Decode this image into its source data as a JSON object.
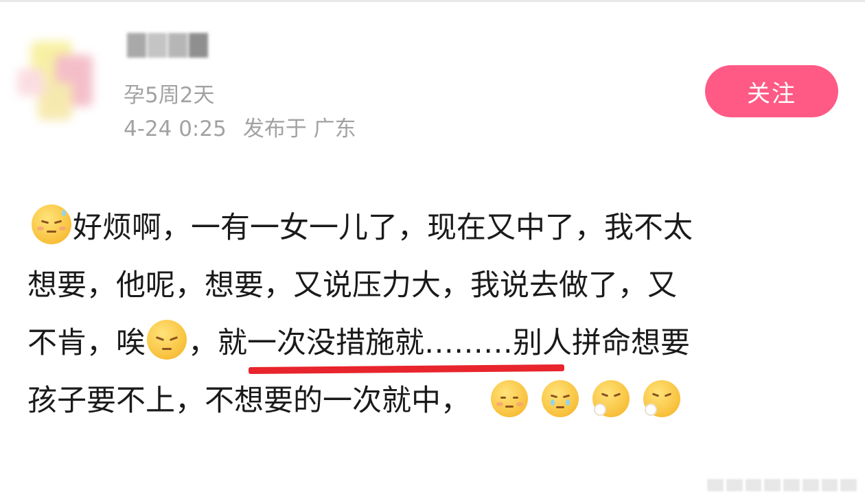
{
  "post": {
    "author": {
      "name_hidden": true,
      "pregnancy_status": "孕5周2天"
    },
    "posted_time": "4-24 0:25",
    "location": "发布于 广东",
    "follow_label": "关注",
    "content": {
      "line1": "好烦啊，一有一女一儿了，现在又中了，我不太",
      "line2": "想要，他呢，想要，又说压力大，我说去做了，又",
      "line3_a": "不肯，唉",
      "line3_b": "，就一次没措施就………别人拼命想要",
      "line4": "孩子要不上，不想要的一次就中，"
    },
    "emoji": {
      "start": "sweat-sad-emoji",
      "inline": "pensive-face-emoji",
      "trailing": [
        "crying-face-emoji",
        "tearful-face-emoji",
        "sighing-face-emoji",
        "sighing-face-emoji"
      ]
    },
    "colors": {
      "follow_button": "#fe5a85",
      "meta_text": "#a2a2a2",
      "body_text": "#1a1a1a",
      "highlight_underline": "#e8242c"
    }
  }
}
